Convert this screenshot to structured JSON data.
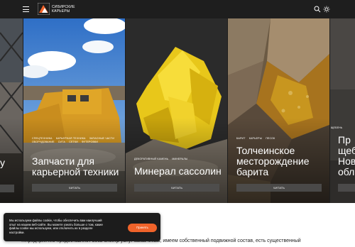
{
  "header": {
    "logo_line1": "СИБИРСКИЕ",
    "logo_line2": "КАРЬЕРЫ"
  },
  "cards": [
    {
      "tags": [
        "Спецтехника",
        "Карьерная техника",
        "Запасные части",
        "Оборудование",
        "Сита",
        "Сетки",
        "Футеровки"
      ],
      "title_line1": "Запчасти для",
      "title_line2": "карьерной техники",
      "button": "Читать"
    },
    {
      "tags": [
        "Декоративный камень",
        "Минералы"
      ],
      "title_line1": "Минерал сассолин",
      "title_line2": "",
      "button": "Читать"
    },
    {
      "tags": [
        "Барит",
        "Карьеры",
        "Песок"
      ],
      "title_line1": "Толчеинское",
      "title_line2": "месторождение",
      "title_line3": "барита",
      "button": "Читать"
    }
  ],
  "left_partial": {
    "title_fragment": "у"
  },
  "right_partial": {
    "tag_fragment": "Щебень",
    "lines": [
      "Пр",
      "щеб",
      "Нов",
      "обл"
    ]
  },
  "bottom": {
    "text": "...предприятие предоставляет весь спектр услуг заказчикам, имеем собственный подвижной состав, есть существенный"
  },
  "cookie": {
    "text": "Мы используем файлы cookie, чтобы обеспечить вам наилучший опыт на нашем веб-сайте. Вы можете узнать больше о том, какие файлы cookie мы используем, или отключить их в разделе настройки.",
    "button": "Принять"
  },
  "colors": {
    "accent": "#f0632a",
    "header_bg": "#1e1e1e"
  }
}
